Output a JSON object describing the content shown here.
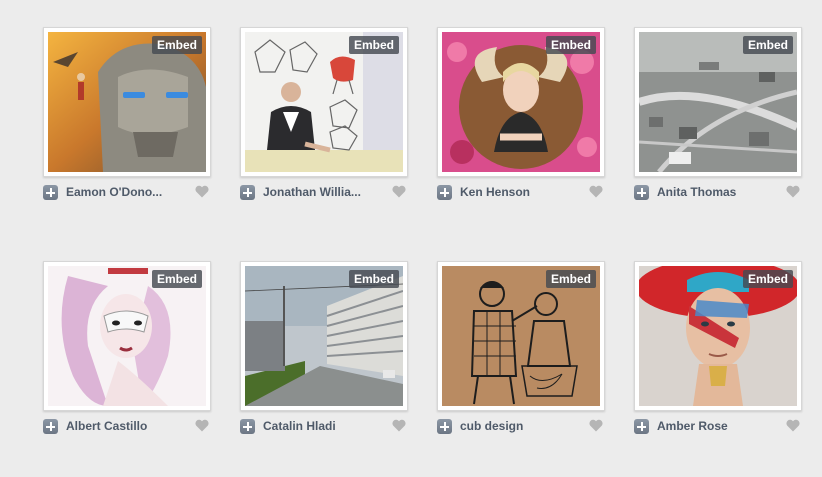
{
  "colors": {
    "background": "#ececec",
    "name_text": "#4f5a69",
    "embed_badge": "#464a52",
    "heart": "#b5b5b5"
  },
  "embed_label": "Embed",
  "icons": {
    "add": "plus-square-icon",
    "like": "heart-icon"
  },
  "projects": [
    {
      "author": "Eamon O'Dono...",
      "art": "robot-illustration"
    },
    {
      "author": "Jonathan Willia...",
      "art": "chair-design-sketch"
    },
    {
      "author": "Ken Henson",
      "art": "horned-girl-painting"
    },
    {
      "author": "Anita Thomas",
      "art": "aerial-city-photo"
    },
    {
      "author": "Albert Castillo",
      "art": "masked-woman-drawing"
    },
    {
      "author": "Catalin Hladi",
      "art": "building-street-photo"
    },
    {
      "author": "cub design",
      "art": "barber-ink-drawing"
    },
    {
      "author": "Amber Rose",
      "art": "painted-face-portrait"
    }
  ]
}
